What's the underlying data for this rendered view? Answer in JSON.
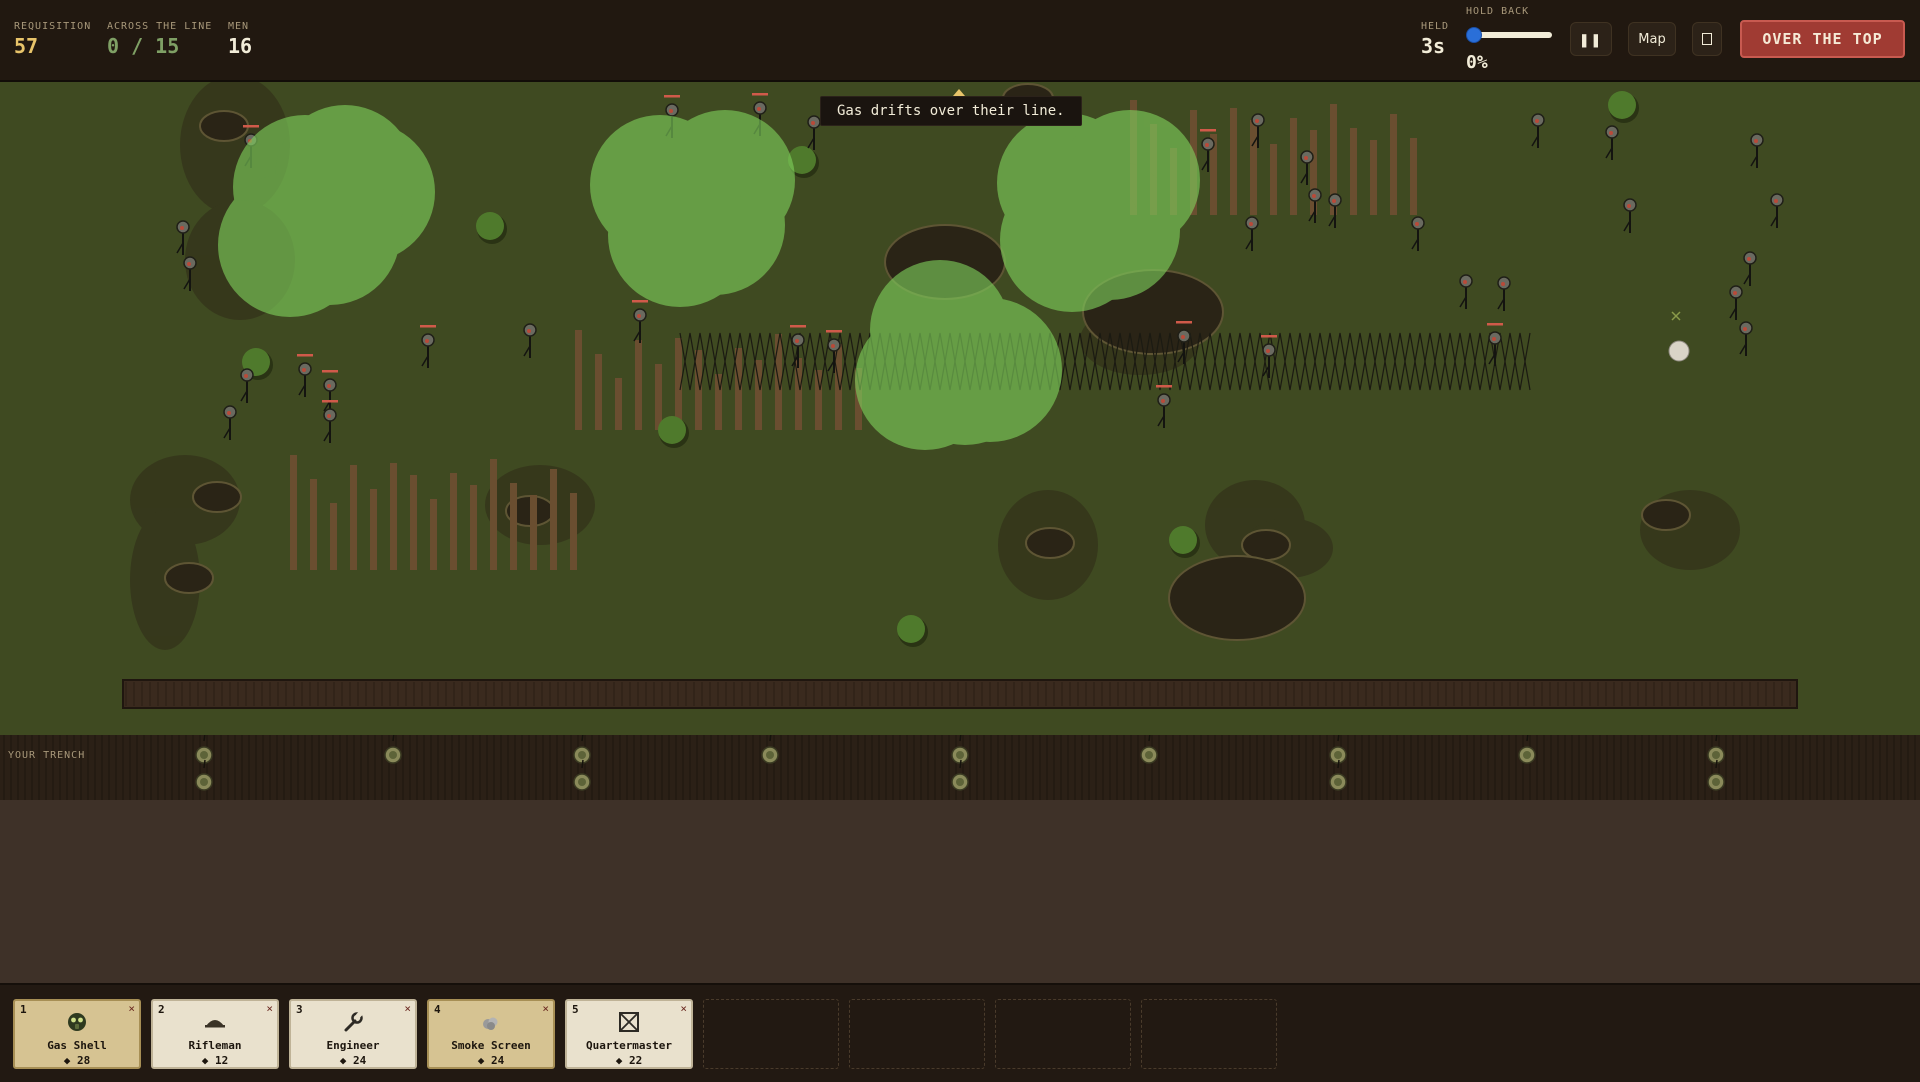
{
  "hud": {
    "requisition": {
      "label": "REQUISITION",
      "value": "57"
    },
    "across": {
      "label": "ACROSS THE LINE",
      "value": "0 / 15"
    },
    "men": {
      "label": "MEN",
      "value": "16"
    },
    "held": {
      "label": "HELD",
      "value": "3s"
    },
    "hold_back": {
      "label": "HOLD BACK",
      "value": "0%",
      "fraction": 0.0
    },
    "pause_label": "❚❚",
    "map_label": "Map",
    "over_label": "OVER THE TOP"
  },
  "toast": "Gas drifts over their line.",
  "trench_label": "YOUR TRENCH",
  "colors": {
    "gas": "#7fd05c",
    "over_the_top": "#a03b33",
    "gold": "#e8c46a",
    "field": "#3f4a21"
  },
  "cards": [
    {
      "key": "1",
      "name": "Gas Shell",
      "cost": "◆ 28",
      "icon": "gas-mask-icon",
      "close": "×"
    },
    {
      "key": "2",
      "name": "Rifleman",
      "cost": "◆ 12",
      "icon": "helmet-icon",
      "close": "×"
    },
    {
      "key": "3",
      "name": "Engineer",
      "cost": "◆ 24",
      "icon": "wrench-icon",
      "close": "×"
    },
    {
      "key": "4",
      "name": "Smoke Screen",
      "cost": "◆ 24",
      "icon": "smoke-icon",
      "close": "×"
    },
    {
      "key": "5",
      "name": "Quartermaster",
      "cost": "◆ 22",
      "icon": "crate-icon",
      "close": "×"
    }
  ]
}
